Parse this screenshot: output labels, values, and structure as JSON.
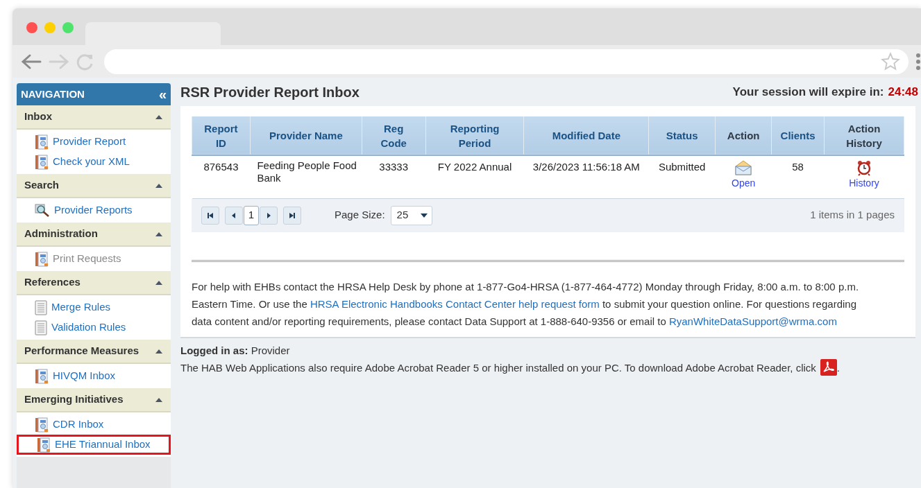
{
  "navigation": {
    "title": "NAVIGATION",
    "collapse": "«",
    "sections": [
      {
        "title": "Inbox",
        "expanded": true,
        "items": [
          {
            "label": "Provider Report",
            "kind": "report",
            "disabled": false,
            "highlighted": false
          },
          {
            "label": "Check your XML",
            "kind": "report",
            "disabled": false,
            "highlighted": false
          }
        ]
      },
      {
        "title": "Search",
        "expanded": true,
        "items": [
          {
            "label": "Provider Reports",
            "kind": "search",
            "disabled": false,
            "highlighted": false
          }
        ]
      },
      {
        "title": "Administration",
        "expanded": true,
        "items": [
          {
            "label": "Print Requests",
            "kind": "report",
            "disabled": true,
            "highlighted": false
          }
        ]
      },
      {
        "title": "References",
        "expanded": true,
        "items": [
          {
            "label": "Merge Rules",
            "kind": "document",
            "disabled": false,
            "highlighted": false
          },
          {
            "label": "Validation Rules",
            "kind": "document",
            "disabled": false,
            "highlighted": false
          }
        ]
      },
      {
        "title": "Performance Measures",
        "expanded": true,
        "items": [
          {
            "label": "HIVQM Inbox",
            "kind": "report",
            "disabled": false,
            "highlighted": false
          }
        ]
      },
      {
        "title": "Emerging Initiatives",
        "expanded": true,
        "items": [
          {
            "label": "CDR Inbox",
            "kind": "report",
            "disabled": false,
            "highlighted": false
          },
          {
            "label": "EHE Triannual Inbox",
            "kind": "report",
            "disabled": false,
            "highlighted": true
          }
        ]
      }
    ]
  },
  "page_title": "RSR Provider Report Inbox",
  "session": {
    "label": "Your session will expire in:",
    "time": "24:48"
  },
  "table": {
    "columns": [
      "Report\nID",
      "Provider Name",
      "Reg\nCode",
      "Reporting\nPeriod",
      "Modified Date",
      "Status",
      "Action",
      "Clients",
      "Action\nHistory"
    ],
    "rows": [
      {
        "report_id": "876543",
        "provider_name": "Feeding People Food Bank",
        "reg_code": "33333",
        "reporting_period": "FY 2022 Annual",
        "modified_date": "3/26/2023 11:56:18 AM",
        "status": "Submitted",
        "action": "Open",
        "clients": "58",
        "action_history": "History"
      }
    ]
  },
  "pager": {
    "page": "1",
    "page_size_label": "Page Size:",
    "page_size": "25",
    "summary": "1 items in 1 pages"
  },
  "help": [
    {
      "kind": "text",
      "text": "For help with EHBs contact the HRSA Help Desk by phone at 1-877-Go4-HRSA (1-877-464-4772) Monday through Friday, 8:00 a.m. to 8:00 p.m. Eastern Time. Or use the "
    },
    {
      "kind": "link",
      "text": "HRSA Electronic Handbooks Contact Center help request form"
    },
    {
      "kind": "text",
      "text": " to submit your question online. For questions regarding data content and/or reporting requirements, please contact Data Support at 1-888-640-9356 or email to "
    },
    {
      "kind": "link",
      "text": "RyanWhiteDataSupport@wrma.com"
    }
  ],
  "footer": {
    "logged_in": "**Logged in as:** Provider",
    "acrobat_text": "The HAB Web Applications also require Adobe Acrobat Reader 5 or higher installed on your PC. To download Adobe Acrobat Reader, click",
    "acrobat_end": "."
  }
}
